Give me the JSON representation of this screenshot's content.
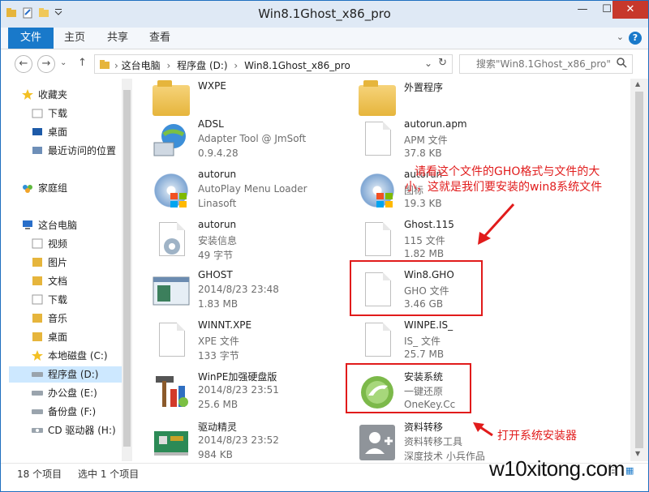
{
  "window": {
    "title": "Win8.1Ghost_x86_pro",
    "min_label": "—",
    "max_label": "☐",
    "close_label": "✕"
  },
  "ribbon": {
    "file_tab": "文件",
    "tabs": [
      "主页",
      "共享",
      "查看"
    ],
    "help": "?"
  },
  "address": {
    "crumbs": [
      "这台电脑",
      "程序盘 (D:)",
      "Win8.1Ghost_x86_pro"
    ],
    "search_placeholder": "搜索\"Win8.1Ghost_x86_pro\""
  },
  "nav": {
    "items": [
      {
        "label": "收藏夹",
        "icon": "star-icon"
      },
      {
        "label": "下载",
        "icon": "download-folder-icon"
      },
      {
        "label": "桌面",
        "icon": "desktop-icon"
      },
      {
        "label": "最近访问的位置",
        "icon": "recent-places-icon"
      },
      {
        "label": "家庭组",
        "icon": "homegroup-icon"
      },
      {
        "label": "这台电脑",
        "icon": "computer-icon"
      },
      {
        "label": "视频",
        "icon": "videos-folder-icon"
      },
      {
        "label": "图片",
        "icon": "pictures-folder-icon"
      },
      {
        "label": "文档",
        "icon": "documents-folder-icon"
      },
      {
        "label": "下载",
        "icon": "download-folder-icon"
      },
      {
        "label": "音乐",
        "icon": "music-folder-icon"
      },
      {
        "label": "桌面",
        "icon": "desktop-folder-icon"
      },
      {
        "label": "本地磁盘 (C:)",
        "icon": "system-drive-icon"
      },
      {
        "label": "程序盘 (D:)",
        "icon": "drive-icon"
      },
      {
        "label": "办公盘 (E:)",
        "icon": "drive-icon"
      },
      {
        "label": "备份盘 (F:)",
        "icon": "drive-icon"
      },
      {
        "label": "CD 驱动器 (H:)",
        "icon": "cd-drive-icon"
      }
    ]
  },
  "files": [
    {
      "name": "WXPE",
      "line2": "",
      "line3": "",
      "icon": "folder-icon"
    },
    {
      "name": "外置程序",
      "line2": "",
      "line3": "",
      "icon": "folder-icon"
    },
    {
      "name": "ADSL",
      "line2": "Adapter Tool @ JmSoft",
      "line3": "0.9.4.28",
      "icon": "network-globe-icon"
    },
    {
      "name": "autorun.apm",
      "line2": "APM 文件",
      "line3": "37.8 KB",
      "icon": "document-icon"
    },
    {
      "name": "autorun",
      "line2": "AutoPlay Menu Loader",
      "line3": "Linasoft",
      "icon": "disc-setup-icon"
    },
    {
      "name": "autorun",
      "line2": "图标",
      "line3": "19.3 KB",
      "icon": "disc-setup-icon"
    },
    {
      "name": "autorun",
      "line2": "安装信息",
      "line3": "49 字节",
      "icon": "setup-info-icon"
    },
    {
      "name": "Ghost.115",
      "line2": "115 文件",
      "line3": "1.82 MB",
      "icon": "document-icon"
    },
    {
      "name": "GHOST",
      "line2": "2014/8/23 23:48",
      "line3": "1.83 MB",
      "icon": "application-window-icon"
    },
    {
      "name": "Win8.GHO",
      "line2": "GHO 文件",
      "line3": "3.46 GB",
      "icon": "document-icon"
    },
    {
      "name": "WINNT.XPE",
      "line2": "XPE 文件",
      "line3": "133 字节",
      "icon": "document-icon"
    },
    {
      "name": "WINPE.IS_",
      "line2": "IS_ 文件",
      "line3": "25.7 MB",
      "icon": "document-icon"
    },
    {
      "name": "WinPE加强硬盘版",
      "line2": "2014/8/23 23:51",
      "line3": "25.6 MB",
      "icon": "hammer-tools-icon"
    },
    {
      "name": "安装系统",
      "line2": "一键还原",
      "line3": "OneKey.Cc",
      "icon": "onekey-restore-icon"
    },
    {
      "name": "驱动精灵",
      "line2": "2014/8/23 23:52",
      "line3": "984 KB",
      "icon": "circuit-board-icon"
    },
    {
      "name": "资料转移",
      "line2": "资料转移工具",
      "line3": "深度技术 小兵作品",
      "icon": "user-transfer-icon"
    }
  ],
  "status": {
    "count": "18 个项目",
    "selected": "选中 1 个项目"
  },
  "annotations": {
    "note1_line1": "请看这个文件的GHO格式与文件的大",
    "note1_line2": "小，这就是我们要安装的win8系统文件",
    "note2": "打开系统安装器",
    "watermark": "w10xitong.com",
    "color": "#e11b1b"
  }
}
